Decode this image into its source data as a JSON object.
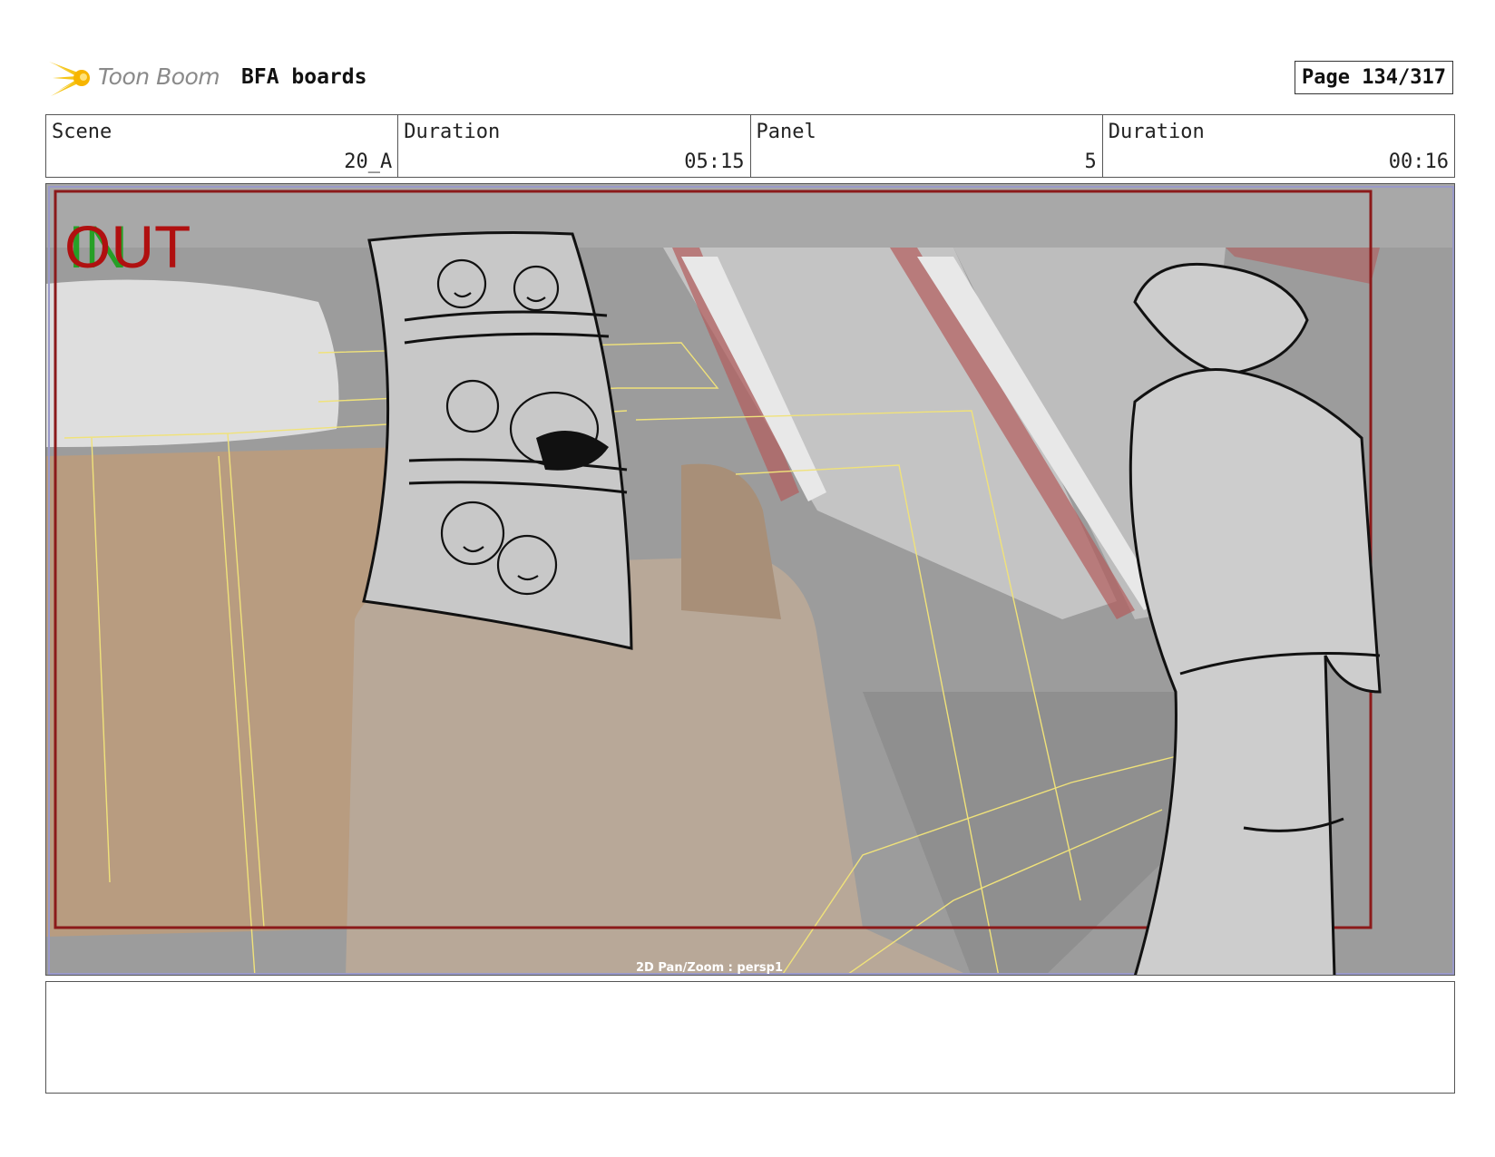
{
  "header": {
    "brand": "Toon Boom",
    "project": "BFA boards",
    "page": "Page 134/317",
    "logo_color": "#f5c518"
  },
  "info": {
    "scene_label": "Scene",
    "scene_value": "20_A",
    "duration_label": "Duration",
    "duration_value": "05:15",
    "panel_label": "Panel",
    "panel_value": "5",
    "panel_duration_label": "Duration",
    "panel_duration_value": "00:16"
  },
  "panel_image": {
    "in_marker": "IN",
    "out_marker": "OUT",
    "in_color": "#1aa01a",
    "out_color": "#b01010",
    "camera_label": "2D Pan/Zoom : persp1",
    "frame_color": "#8b1a1a"
  },
  "notes": {
    "text": ""
  }
}
